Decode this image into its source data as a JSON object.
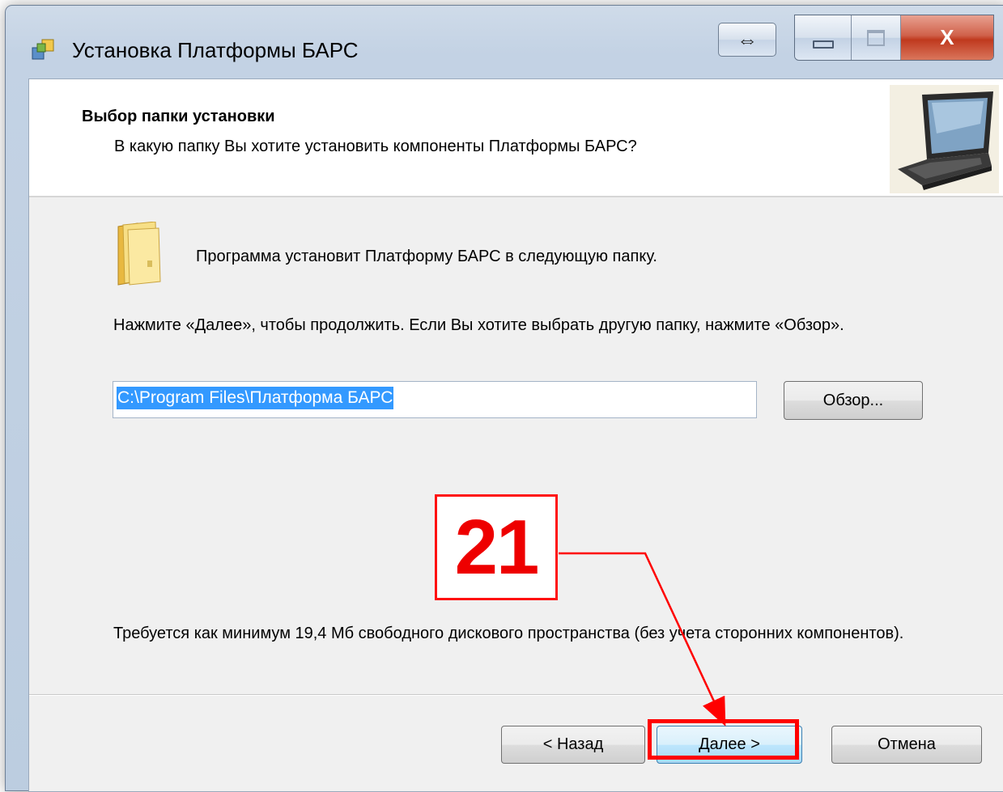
{
  "window": {
    "title": "Установка Платформы БАРС",
    "close_glyph": "X",
    "resize_glyph": "⇔"
  },
  "header": {
    "title": "Выбор папки установки",
    "subtitle": "В какую папку Вы хотите установить компоненты Платформы БАРС?"
  },
  "body": {
    "info": "Программа установит Платформу БАРС в следующую папку.",
    "instructions": "Нажмите «Далее», чтобы продолжить. Если Вы хотите выбрать другую папку, нажмите «Обзор».",
    "path_value": "C:\\Program Files\\Платформа БАРС",
    "browse_label": "Обзор...",
    "requirement": "Требуется как минимум 19,4 Мб свободного дискового пространства (без учета сторонних компонентов)."
  },
  "footer": {
    "back_label": "< Назад",
    "next_label": "Далее >",
    "cancel_label": "Отмена"
  },
  "annotation": {
    "step_number": "21",
    "color": "#ff0000"
  }
}
